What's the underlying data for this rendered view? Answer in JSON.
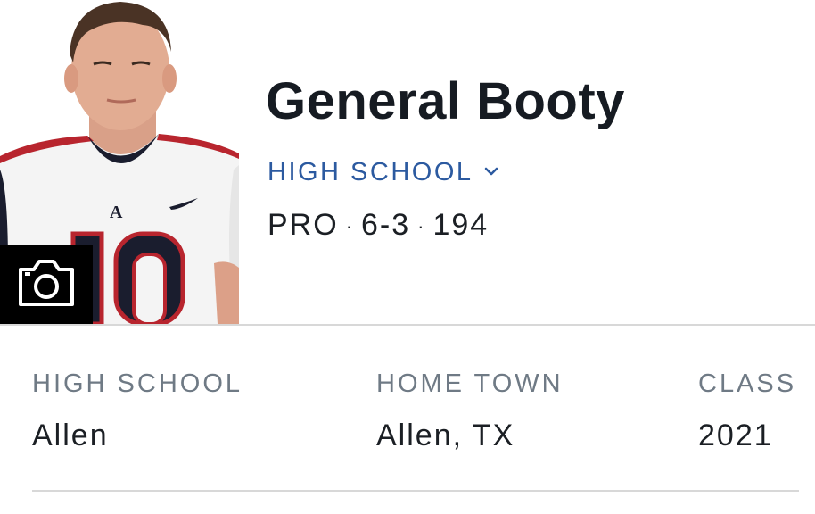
{
  "player": {
    "name": "General Booty",
    "level": "HIGH SCHOOL",
    "position": "PRO",
    "height": "6-3",
    "weight": "194",
    "separator": "·",
    "photo_icon": "player-photo",
    "camera_icon": "camera-icon",
    "chevron_icon": "chevron-down-icon"
  },
  "info": [
    {
      "label": "HIGH SCHOOL",
      "value": "Allen"
    },
    {
      "label": "HOME TOWN",
      "value": "Allen, TX"
    },
    {
      "label": "CLASS",
      "value": "2021"
    }
  ],
  "colors": {
    "name_text": "#161b22",
    "link_blue": "#2c5aa0",
    "label_gray": "#6f7a85",
    "divider": "#d8d8d8"
  }
}
